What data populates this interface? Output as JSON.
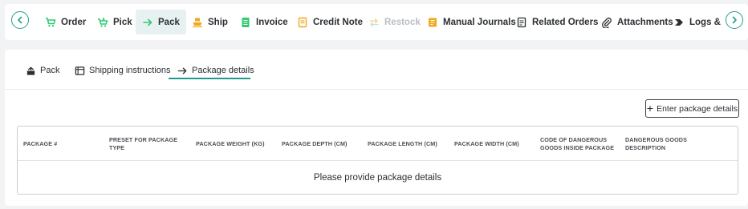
{
  "top_tabs": [
    {
      "label": "Order",
      "icon": "cart-icon"
    },
    {
      "label": "Pick",
      "icon": "pick-cart-icon"
    },
    {
      "label": "Pack",
      "icon": "arrow-right-icon",
      "active": true
    },
    {
      "label": "Ship",
      "icon": "ship-icon"
    },
    {
      "label": "Invoice",
      "icon": "invoice-icon"
    },
    {
      "label": "Credit Note",
      "icon": "credit-note-icon"
    },
    {
      "label": "Restock",
      "icon": "restock-icon",
      "disabled": true
    },
    {
      "label": "Manual Journals",
      "icon": "journal-icon"
    },
    {
      "label": "Related Orders",
      "icon": "related-orders-icon"
    },
    {
      "label": "Attachments",
      "icon": "paperclip-icon"
    },
    {
      "label": "Logs & Attri",
      "icon": "logs-icon"
    }
  ],
  "sub_tabs": [
    {
      "label": "Pack",
      "icon": "pack-icon"
    },
    {
      "label": "Shipping instructions",
      "icon": "list-icon"
    },
    {
      "label": "Package details",
      "icon": "arrow-right-icon",
      "active": true
    }
  ],
  "enter_button": {
    "label": "Enter package details"
  },
  "table": {
    "columns": [
      "PACKAGE #",
      "PRESET FOR PACKAGE TYPE",
      "PACKAGE WEIGHT (KG)",
      "PACKAGE DEPTH (CM)",
      "PACKAGE LENGTH (CM)",
      "PACKAGE WIDTH (CM)",
      "CODE OF DANGEROUS GOODS INSIDE PACKAGE",
      "DANGEROUS GOODS DESCRIPTION"
    ],
    "empty_message": "Please provide package details"
  },
  "colors": {
    "accent": "#1f9a8a",
    "green_icon": "#2ecb71",
    "orange_icon": "#f0a81c",
    "dark_text": "#2b2f33"
  }
}
